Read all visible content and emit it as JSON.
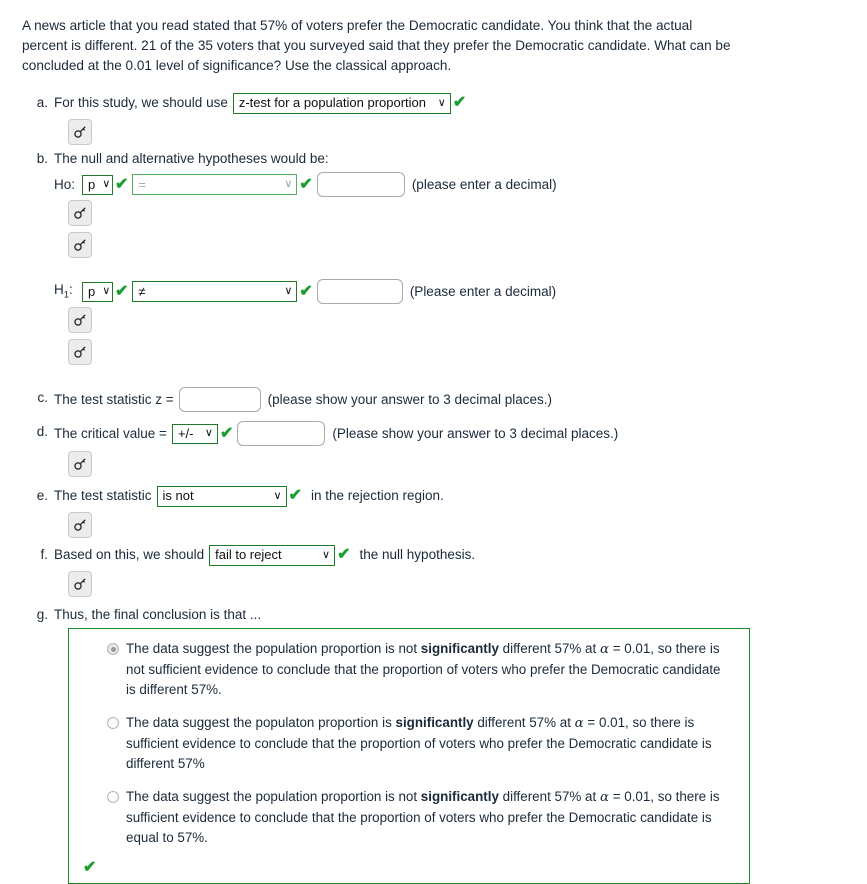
{
  "problem": {
    "text": "A news article that you read stated that 57% of voters prefer the Democratic candidate. You think that the actual percent is different. 21 of the 35 voters that you surveyed said that they prefer the Democratic candidate. What can be concluded at the 0.01 level of significance? Use the classical approach."
  },
  "items": {
    "a": {
      "letter": "a.",
      "prefix": "For this study, we should use",
      "select_value": "z-test for a population proportion",
      "check": "✔"
    },
    "b": {
      "letter": "b.",
      "prompt": "The null and alternative hypotheses would be:",
      "null_label": "Ho:",
      "null_param": "p",
      "null_operator": "=",
      "null_value": "",
      "null_hint": "(please enter a decimal)",
      "alt_label_main": "H",
      "alt_label_sub": "1",
      "alt_label_colon": ":",
      "alt_param": "p",
      "alt_operator": "≠",
      "alt_value": "",
      "alt_hint": "(Please enter a decimal)",
      "check": "✔"
    },
    "c": {
      "letter": "c.",
      "prefix": "The test statistic z =",
      "value": "",
      "hint": "(please show your answer to 3 decimal places.)"
    },
    "d": {
      "letter": "d.",
      "prefix": "The critical value =",
      "sign": "+/-",
      "value": "",
      "hint": "(Please show your answer to 3 decimal places.)",
      "check": "✔"
    },
    "e": {
      "letter": "e.",
      "prefix": "The test statistic",
      "select_value": "is not",
      "suffix": "in the rejection region.",
      "check": "✔"
    },
    "f": {
      "letter": "f.",
      "prefix": "Based on this, we should",
      "select_value": "fail to reject",
      "suffix": "the null hypothesis.",
      "check": "✔"
    },
    "g": {
      "letter": "g.",
      "prompt": "Thus, the final conclusion is that ...",
      "box_check": "✔",
      "choices": [
        {
          "selected": true,
          "parts": [
            {
              "t": "The data suggest the population proportion is not ",
              "b": false
            },
            {
              "t": "significantly",
              "b": true
            },
            {
              "t": " different 57% at ",
              "b": false
            },
            {
              "t": "α",
              "b": false,
              "alpha": true
            },
            {
              "t": " = 0.01, so there is not sufficient evidence to conclude that the proportion of voters who prefer the Democratic candidate is different 57%.",
              "b": false
            }
          ]
        },
        {
          "selected": false,
          "parts": [
            {
              "t": "The data suggest the populaton proportion is ",
              "b": false
            },
            {
              "t": "significantly",
              "b": true
            },
            {
              "t": " different 57% at ",
              "b": false
            },
            {
              "t": "α",
              "b": false,
              "alpha": true
            },
            {
              "t": " = 0.01, so there is sufficient evidence to conclude that the proportion of voters who prefer the Democratic candidate is different 57%",
              "b": false
            }
          ]
        },
        {
          "selected": false,
          "parts": [
            {
              "t": "The data suggest the population proportion is not ",
              "b": false
            },
            {
              "t": "significantly",
              "b": true
            },
            {
              "t": " different 57% at ",
              "b": false
            },
            {
              "t": "α",
              "b": false,
              "alpha": true
            },
            {
              "t": " = 0.01, so there is sufficient evidence to conclude that the proportion of voters who prefer the Democratic candidate is equal to 57%.",
              "b": false
            }
          ]
        }
      ]
    }
  },
  "icons": {
    "key": "key-icon",
    "chevron": "∨"
  },
  "colors": {
    "select_border_green": "#1f7a29",
    "select_border_light_green": "#52ae5c",
    "check_green": "#1c9e2e",
    "box_green": "#1f8a28",
    "text": "#1b2a3a"
  }
}
